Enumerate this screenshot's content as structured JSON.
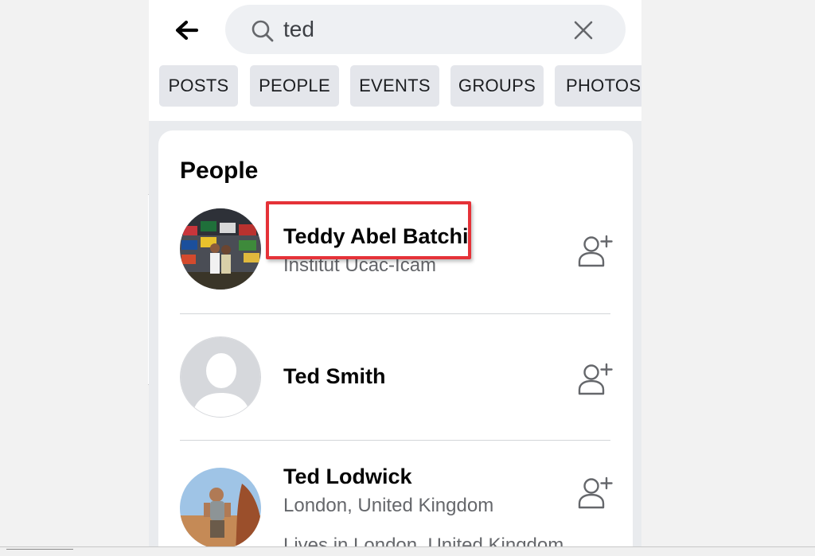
{
  "search": {
    "query": "ted",
    "back_icon": "back-arrow-icon",
    "search_icon": "search-icon",
    "clear_icon": "close-icon"
  },
  "filters": [
    "POSTS",
    "PEOPLE",
    "EVENTS",
    "GROUPS",
    "PHOTOS"
  ],
  "people": {
    "title": "People",
    "results": [
      {
        "name": "Teddy Abel Batchi",
        "subtitle": "Institut Ucac-Icam",
        "highlighted": true,
        "action_icon": "add-friend-icon"
      },
      {
        "name": "Ted Smith",
        "subtitle": "",
        "action_icon": "add-friend-icon"
      },
      {
        "name": "Ted Lodwick",
        "subtitle": "London, United Kingdom",
        "detail": "Lives in London, United Kingdom",
        "action_icon": "add-friend-icon"
      }
    ]
  },
  "colors": {
    "highlight": "#e53238",
    "chip_bg": "#e4e6eb",
    "search_bg": "#eef0f3"
  }
}
